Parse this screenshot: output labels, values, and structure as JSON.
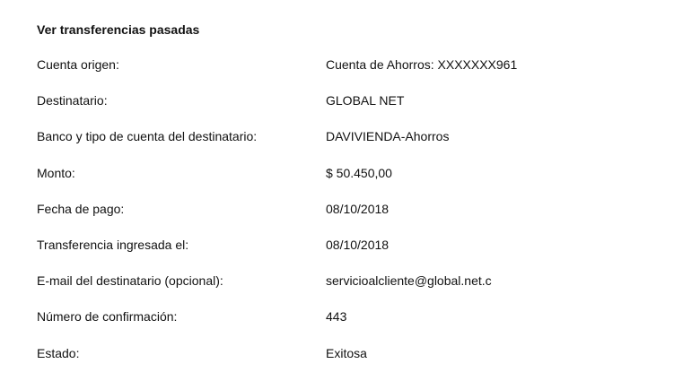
{
  "page": {
    "title": "Ver transferencias pasadas"
  },
  "details": [
    {
      "label": "Cuenta origen:",
      "value": "Cuenta de Ahorros: XXXXXXX961"
    },
    {
      "label": "Destinatario:",
      "value": "GLOBAL NET"
    },
    {
      "label": "Banco y tipo de cuenta del destinatario:",
      "value": "DAVIVIENDA-Ahorros"
    },
    {
      "label": "Monto:",
      "value": "$ 50.450,00"
    },
    {
      "label": "Fecha de pago:",
      "value": "08/10/2018"
    },
    {
      "label": "Transferencia ingresada el:",
      "value": "08/10/2018"
    },
    {
      "label": "E-mail del destinatario (opcional):",
      "value": "servicioalcliente@global.net.c"
    },
    {
      "label": "Número de confirmación:",
      "value": "443"
    },
    {
      "label": "Estado:",
      "value": "Exitosa"
    }
  ]
}
